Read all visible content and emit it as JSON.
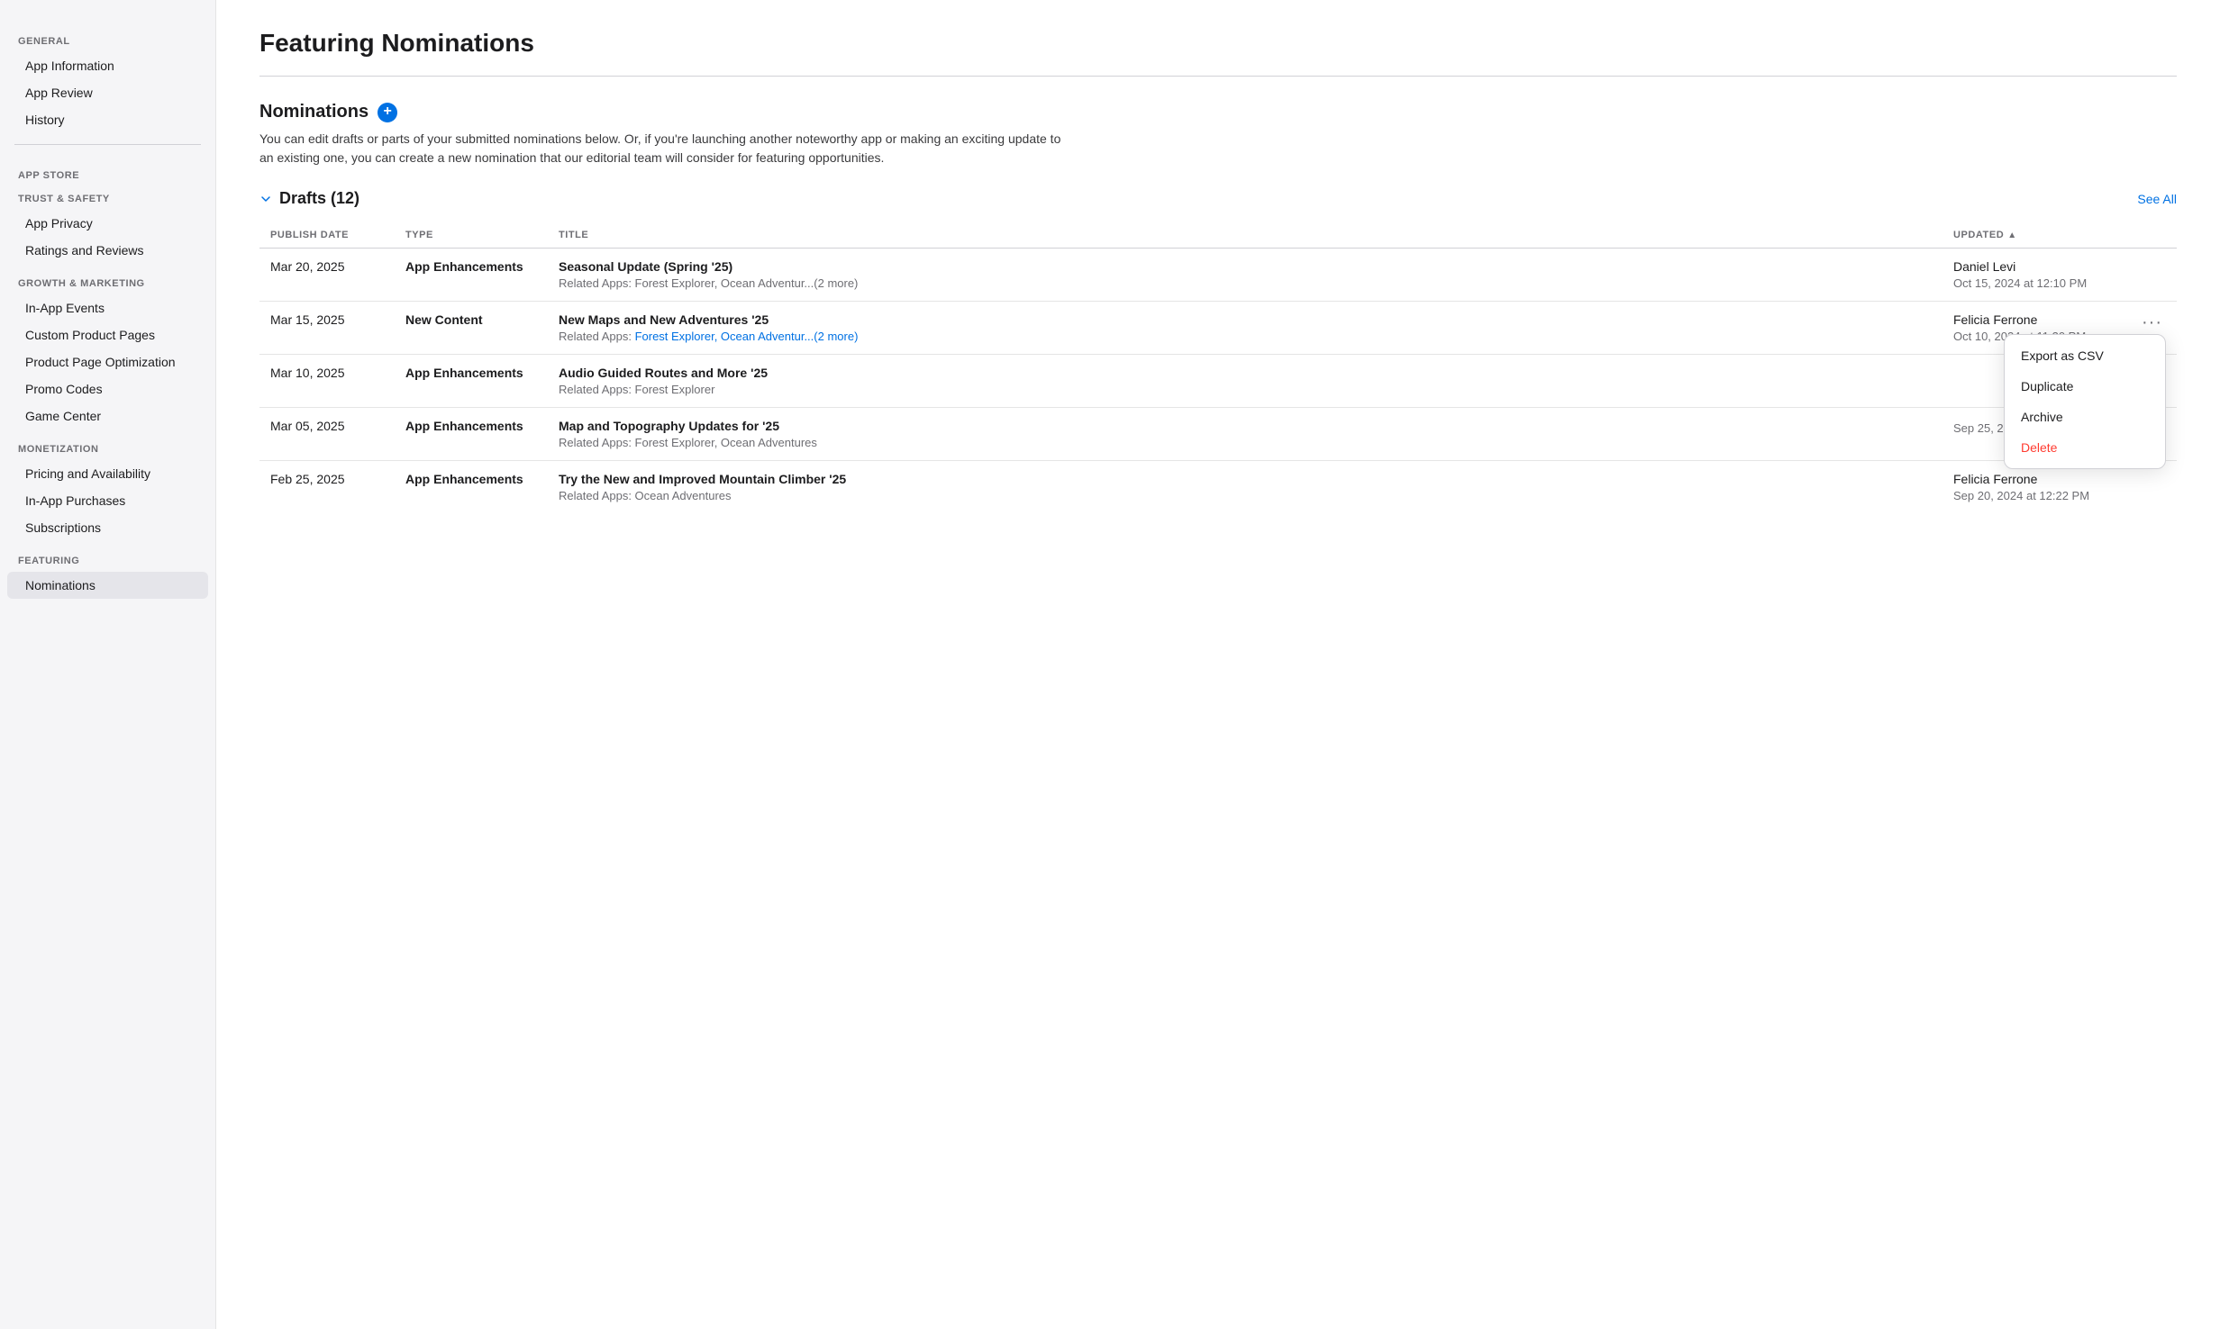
{
  "sidebar": {
    "general_label": "General",
    "items_general": [
      {
        "id": "app-information",
        "label": "App Information"
      },
      {
        "id": "app-review",
        "label": "App Review"
      },
      {
        "id": "history",
        "label": "History"
      }
    ],
    "app_store_label": "App Store",
    "trust_safety_label": "TRUST & SAFETY",
    "items_trust": [
      {
        "id": "app-privacy",
        "label": "App Privacy"
      },
      {
        "id": "ratings-reviews",
        "label": "Ratings and Reviews"
      }
    ],
    "growth_marketing_label": "GROWTH & MARKETING",
    "items_growth": [
      {
        "id": "in-app-events",
        "label": "In-App Events"
      },
      {
        "id": "custom-product-pages",
        "label": "Custom Product Pages"
      },
      {
        "id": "product-page-optimization",
        "label": "Product Page Optimization"
      },
      {
        "id": "promo-codes",
        "label": "Promo Codes"
      },
      {
        "id": "game-center",
        "label": "Game Center"
      }
    ],
    "monetization_label": "MONETIZATION",
    "items_monetization": [
      {
        "id": "pricing-availability",
        "label": "Pricing and Availability"
      },
      {
        "id": "in-app-purchases",
        "label": "In-App Purchases"
      },
      {
        "id": "subscriptions",
        "label": "Subscriptions"
      }
    ],
    "featuring_label": "FEATURING",
    "items_featuring": [
      {
        "id": "nominations",
        "label": "Nominations"
      }
    ]
  },
  "page": {
    "title": "Featuring Nominations",
    "section_title": "Nominations",
    "add_btn_label": "+",
    "description": "You can edit drafts or parts of your submitted nominations below. Or, if you're launching another noteworthy app or making an exciting update to an existing one, you can create a new nomination that our editorial team will consider for featuring opportunities.",
    "drafts_label": "Drafts (12)",
    "see_all_label": "See All"
  },
  "table": {
    "columns": [
      {
        "id": "publish-date",
        "label": "PUBLISH DATE"
      },
      {
        "id": "type",
        "label": "TYPE"
      },
      {
        "id": "title",
        "label": "TITLE"
      },
      {
        "id": "updated",
        "label": "UPDATED"
      }
    ],
    "rows": [
      {
        "publish_date": "Mar 20, 2025",
        "type": "App Enhancements",
        "title": "Seasonal Update (Spring '25)",
        "related_apps": "Forest Explorer, Ocean Adventur...(2 more)",
        "related_apps_link": false,
        "updated_by": "Daniel Levi",
        "updated_at": "Oct 15, 2024 at 12:10 PM",
        "show_menu": false
      },
      {
        "publish_date": "Mar 15, 2025",
        "type": "New Content",
        "title": "New Maps and New Adventures '25",
        "related_apps": "Forest Explorer, Ocean Adventur...(2 more)",
        "related_apps_link": true,
        "updated_by": "Felicia Ferrone",
        "updated_at": "Oct 10, 2024 at 11:30 PM",
        "show_menu": true
      },
      {
        "publish_date": "Mar 10, 2025",
        "type": "App Enhancements",
        "title": "Audio Guided Routes and More '25",
        "related_apps": "Forest Explorer",
        "related_apps_link": false,
        "updated_by": "",
        "updated_at": "",
        "show_menu": false
      },
      {
        "publish_date": "Mar 05, 2025",
        "type": "App Enhancements",
        "title": "Map and Topography Updates for '25",
        "related_apps": "Forest Explorer, Ocean Adventures",
        "related_apps_link": false,
        "updated_by": "",
        "updated_at": "Sep 25, 2024 at 10:53 AM",
        "show_menu": false
      },
      {
        "publish_date": "Feb 25, 2025",
        "type": "App Enhancements",
        "title": "Try the New and Improved Mountain Climber '25",
        "related_apps": "Ocean Adventures",
        "related_apps_link": false,
        "updated_by": "Felicia Ferrone",
        "updated_at": "Sep 20, 2024 at 12:22 PM",
        "show_menu": false
      }
    ]
  },
  "dropdown": {
    "items": [
      {
        "id": "export-csv",
        "label": "Export as CSV",
        "danger": false
      },
      {
        "id": "duplicate",
        "label": "Duplicate",
        "danger": false
      },
      {
        "id": "archive",
        "label": "Archive",
        "danger": false
      },
      {
        "id": "delete",
        "label": "Delete",
        "danger": true
      }
    ]
  }
}
